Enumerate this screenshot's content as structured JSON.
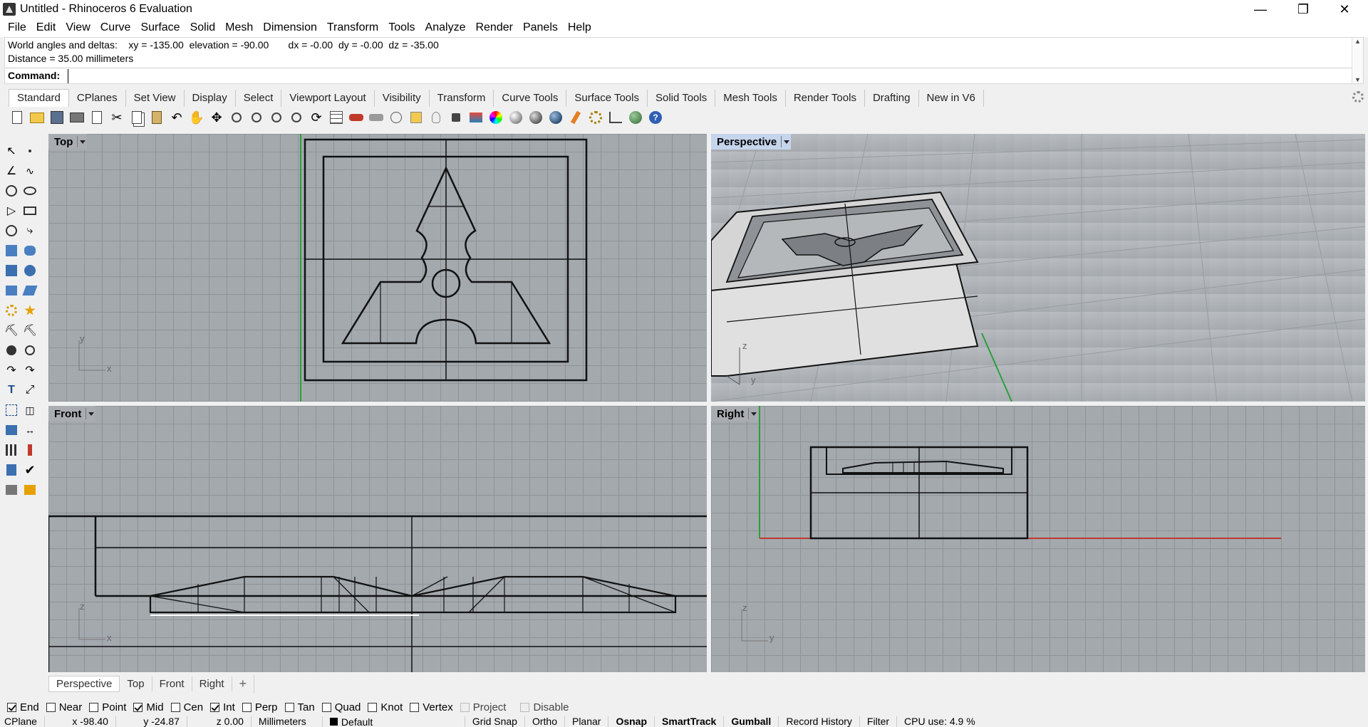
{
  "window": {
    "title": "Untitled - Rhinoceros 6 Evaluation"
  },
  "menu": [
    "File",
    "Edit",
    "View",
    "Curve",
    "Surface",
    "Solid",
    "Mesh",
    "Dimension",
    "Transform",
    "Tools",
    "Analyze",
    "Render",
    "Panels",
    "Help"
  ],
  "command": {
    "history_line1": "World angles and deltas:    xy = -135.00  elevation = -90.00       dx = -0.00  dy = -0.00  dz = -35.00",
    "history_line2": "Distance = 35.00 millimeters",
    "prompt": "Command:",
    "input_value": ""
  },
  "tabs": [
    "Standard",
    "CPlanes",
    "Set View",
    "Display",
    "Select",
    "Viewport Layout",
    "Visibility",
    "Transform",
    "Curve Tools",
    "Surface Tools",
    "Solid Tools",
    "Mesh Tools",
    "Render Tools",
    "Drafting",
    "New in V6"
  ],
  "toolbar_icons": [
    "new-icon",
    "open-icon",
    "save-icon",
    "print-icon",
    "import-icon",
    "cut-icon",
    "copy-icon",
    "paste-icon",
    "undo-icon",
    "pan-hand-icon",
    "move-view-icon",
    "zoom-icon",
    "zoom-window-icon",
    "zoom-extents-icon",
    "zoom-selected-icon",
    "rotate-view-icon",
    "grid-icon",
    "car-icon",
    "tank-icon",
    "cplane-icon",
    "named-views-icon",
    "light-icon",
    "lock-icon",
    "layer-icon",
    "color-wheel-icon",
    "material-icon",
    "rendered-icon",
    "sphere-icon",
    "brush-icon",
    "options-icon",
    "hierarchy-icon",
    "globe-icon",
    "help-icon"
  ],
  "viewports": {
    "top": {
      "label": "Top",
      "axis_x": "x",
      "axis_y": "y"
    },
    "perspective": {
      "label": "Perspective",
      "axis_y": "y",
      "axis_z": "z"
    },
    "front": {
      "label": "Front",
      "axis_x": "x",
      "axis_z": "z"
    },
    "right": {
      "label": "Right",
      "axis_y": "y",
      "axis_z": "z"
    }
  },
  "viewport_tabs": [
    "Perspective",
    "Top",
    "Front",
    "Right",
    "+"
  ],
  "osnap": [
    {
      "label": "End",
      "checked": true
    },
    {
      "label": "Near",
      "checked": false
    },
    {
      "label": "Point",
      "checked": false
    },
    {
      "label": "Mid",
      "checked": true
    },
    {
      "label": "Cen",
      "checked": false
    },
    {
      "label": "Int",
      "checked": true
    },
    {
      "label": "Perp",
      "checked": false
    },
    {
      "label": "Tan",
      "checked": false
    },
    {
      "label": "Quad",
      "checked": false
    },
    {
      "label": "Knot",
      "checked": false
    },
    {
      "label": "Vertex",
      "checked": false
    },
    {
      "label": "Project",
      "checked": false,
      "disabled": true
    },
    {
      "label": "Disable",
      "checked": false,
      "disabled": true
    }
  ],
  "status": {
    "cplane": "CPlane",
    "x": "x -98.40",
    "y": "y -24.87",
    "z": "z 0.00",
    "units": "Millimeters",
    "layer": "Default",
    "grid_snap": "Grid Snap",
    "ortho": "Ortho",
    "planar": "Planar",
    "osnap": "Osnap",
    "smarttrack": "SmartTrack",
    "gumball": "Gumball",
    "record_history": "Record History",
    "filter": "Filter",
    "cpu": "CPU use: 4.9 %"
  },
  "colors": {
    "viewport_bg": "#a4a9ae",
    "grid": "#8e9398",
    "x_axis": "#c0392b",
    "y_axis": "#2e9e3e",
    "active_title": "#c5d5ec"
  }
}
